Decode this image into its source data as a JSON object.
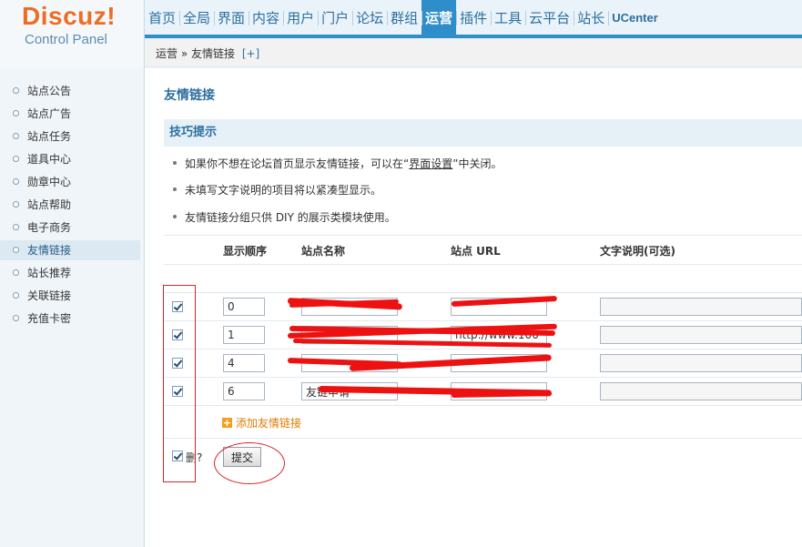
{
  "logo": {
    "title": "Discuz!",
    "subtitle": "Control Panel"
  },
  "nav": {
    "items": [
      "首页",
      "全局",
      "界面",
      "内容",
      "用户",
      "门户",
      "论坛",
      "群组",
      "运营",
      "插件",
      "工具",
      "云平台",
      "站长",
      "UCenter"
    ],
    "active": "运营"
  },
  "breadcrumb": {
    "path": "运营 » 友情链接",
    "toggle": "[+]"
  },
  "sidebar": {
    "items": [
      "站点公告",
      "站点广告",
      "站点任务",
      "道具中心",
      "勋章中心",
      "站点帮助",
      "电子商务",
      "友情链接",
      "站长推荐",
      "关联链接",
      "充值卡密"
    ],
    "active": "友情链接"
  },
  "page": {
    "title": "友情链接"
  },
  "tips": {
    "heading": "技巧提示",
    "line1_before": "如果你不想在论坛首页显示友情链接，可以在“",
    "line1_link": "界面设置",
    "line1_after": "”中关闭。",
    "line2": "未填写文字说明的项目将以紧凑型显示。",
    "line3": "友情链接分组只供 DIY 的展示类模块使用。"
  },
  "table": {
    "headers": {
      "order": "显示顺序",
      "name": "站点名称",
      "url": "站点 URL",
      "desc": "文字说明(可选)"
    },
    "rows": [
      {
        "checked": true,
        "order": "0",
        "name": "",
        "url": "",
        "desc": ""
      },
      {
        "checked": true,
        "order": "1",
        "name": "",
        "url": "http://www.100",
        "desc": ""
      },
      {
        "checked": true,
        "order": "4",
        "name": "",
        "url": "",
        "desc": ""
      },
      {
        "checked": true,
        "order": "6",
        "name": "友链申请",
        "url": "",
        "desc": ""
      }
    ],
    "add_link": "添加友情链接",
    "delete_label": "删?",
    "submit_label": "提交"
  },
  "colors": {
    "accent": "#2f8ec9",
    "logo": "#ec6d25",
    "annotation": "#dd2222"
  }
}
